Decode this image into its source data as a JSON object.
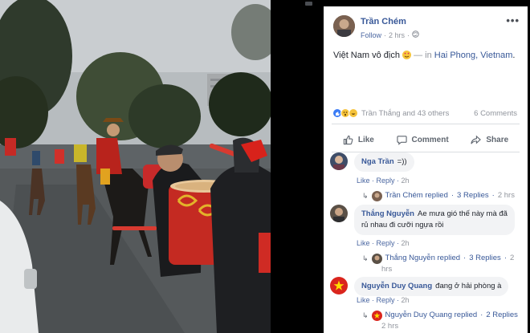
{
  "post": {
    "author": "Trần Chém",
    "follow_label": "Follow",
    "time": "2 hrs",
    "text_main": "Việt Nam vô địch",
    "text_dash": " — in ",
    "location": "Hai Phong, Vietnam",
    "text_end": "."
  },
  "reactions": {
    "summary": "Trần Thắng and 43 others",
    "comment_count": "6 Comments"
  },
  "actions": {
    "like": "Like",
    "comment": "Comment",
    "share": "Share"
  },
  "comments": [
    {
      "name": "Nga Trần",
      "text": "=))",
      "like": "Like",
      "reply": "Reply",
      "time": "2h",
      "replies_author": "Trần Chém replied",
      "replies_count": "3 Replies",
      "replies_time": "2 hrs"
    },
    {
      "name": "Thắng Nguyễn",
      "text_line1": "Ae mưa gió thế này mà đã",
      "text_line2": "rủ nhau đi cưỡi ngựa rồi",
      "like": "Like",
      "reply": "Reply",
      "time": "2h",
      "replies_author": "Thắng Nguyễn replied",
      "replies_count": "3 Replies",
      "replies_time_a": "2",
      "replies_time_b": "hrs"
    },
    {
      "name": "Nguyễn Duy Quang",
      "text": "đang ở hải phòng à",
      "like": "Like",
      "reply": "Reply",
      "time": "2h",
      "replies_author": "Nguyễn Duy Quang replied",
      "replies_count": "2 Replies",
      "replies_time": "2 hrs"
    }
  ],
  "colors": {
    "link": "#385898",
    "muted": "#90949c",
    "bubble": "#f2f3f5",
    "flag_red": "#da251d",
    "flag_star": "#ffde00"
  }
}
